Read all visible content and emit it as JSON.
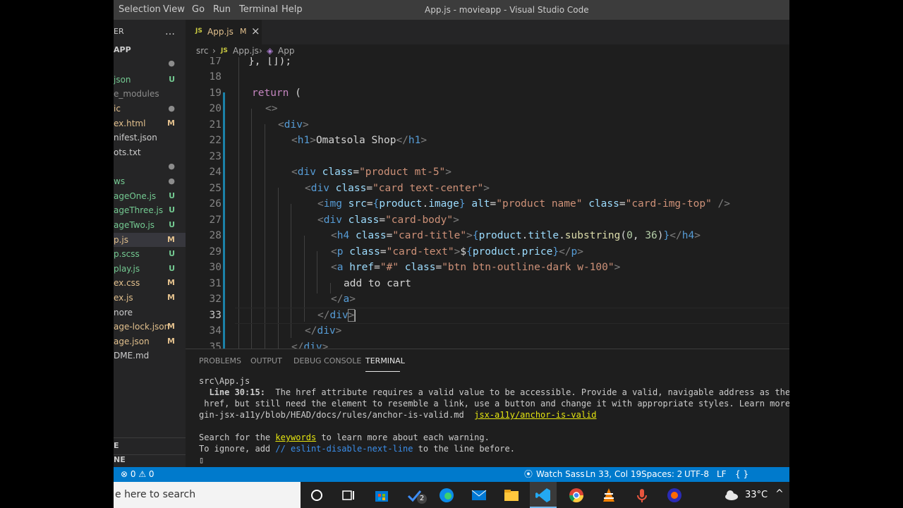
{
  "titlebar": {
    "menus": [
      "Selection",
      "View",
      "Go",
      "Run",
      "Terminal",
      "Help"
    ],
    "title": "App.js - movieapp - Visual Studio Code"
  },
  "sidebar": {
    "header_fragment": "ER",
    "more_icon": "…",
    "project_fragment": "APP",
    "items": [
      {
        "name": "",
        "status": "●",
        "color": "ign"
      },
      {
        "name": "json",
        "status": "U",
        "color": "untracked"
      },
      {
        "name": "e_modules",
        "status": "",
        "color": "ign"
      },
      {
        "name": "ic",
        "status": "●",
        "color": "mod"
      },
      {
        "name": "ex.html",
        "status": "M",
        "color": "mod"
      },
      {
        "name": "nifest.json",
        "status": "",
        "color": "def"
      },
      {
        "name": "ots.txt",
        "status": "",
        "color": "def"
      },
      {
        "name": "",
        "status": "●",
        "color": "ign"
      },
      {
        "name": "ws",
        "status": "●",
        "color": "untracked"
      },
      {
        "name": "ageOne.js",
        "status": "U",
        "color": "untracked"
      },
      {
        "name": "ageThree.js",
        "status": "U",
        "color": "untracked"
      },
      {
        "name": "ageTwo.js",
        "status": "U",
        "color": "untracked"
      },
      {
        "name": "p.js",
        "status": "M",
        "color": "mod"
      },
      {
        "name": "p.scss",
        "status": "U",
        "color": "untracked"
      },
      {
        "name": "play.js",
        "status": "U",
        "color": "untracked"
      },
      {
        "name": "ex.css",
        "status": "M",
        "color": "mod"
      },
      {
        "name": "ex.js",
        "status": "M",
        "color": "mod"
      },
      {
        "name": "nore",
        "status": "",
        "color": "def"
      },
      {
        "name": "age-lock.json",
        "status": "M",
        "color": "mod"
      },
      {
        "name": "age.json",
        "status": "M",
        "color": "mod"
      },
      {
        "name": "DME.md",
        "status": "",
        "color": "def"
      }
    ],
    "bottom_1": "E",
    "bottom_2": "NE"
  },
  "tab": {
    "badge": "JS",
    "name": "App.js",
    "status": "M",
    "close": "×"
  },
  "breadcrumb": {
    "folder": "src",
    "sep": "›",
    "badge": "JS",
    "file": "App.js",
    "symbol": "App"
  },
  "line_numbers": [
    "17",
    "18",
    "19",
    "20",
    "21",
    "22",
    "23",
    "24",
    "25",
    "26",
    "27",
    "28",
    "29",
    "30",
    "31",
    "32",
    "33",
    "34",
    "35"
  ],
  "code": {
    "l17": [
      "}, [",
      "]);"
    ],
    "l19": [
      "return",
      " ("
    ],
    "l20": "<>",
    "l21": [
      "<",
      "div",
      ">"
    ],
    "l22": [
      "<",
      "h1",
      ">",
      "Omatsola Shop",
      "</",
      "h1",
      ">"
    ],
    "l24": [
      "<",
      "div",
      " ",
      "class",
      "=",
      "\"product mt-5\"",
      ">"
    ],
    "l25": [
      "<",
      "div",
      " ",
      "class",
      "=",
      "\"card text-center\"",
      ">"
    ],
    "l26": [
      "<",
      "img",
      " ",
      "src",
      "=",
      "{",
      "product",
      ".",
      "image",
      "}",
      " ",
      "alt",
      "=",
      "\"product name\"",
      " ",
      "class",
      "=",
      "\"card-img-top\"",
      " ",
      "/>"
    ],
    "l27": [
      "<",
      "div",
      " ",
      "class",
      "=",
      "\"card-body\"",
      ">"
    ],
    "l28": [
      "<",
      "h4",
      " ",
      "class",
      "=",
      "\"card-title\"",
      ">",
      "{",
      "product",
      ".",
      "title",
      ".",
      "substring",
      "(",
      "0",
      ", ",
      "36",
      ")",
      "}",
      "</",
      "h4",
      ">"
    ],
    "l29": [
      "<",
      "p",
      " ",
      "class",
      "=",
      "\"card-text\"",
      ">",
      "$",
      "{",
      "product",
      ".",
      "price",
      "}",
      "</",
      "p",
      ">"
    ],
    "l30": [
      "<",
      "a",
      " ",
      "href",
      "=",
      "\"#\"",
      " ",
      "class",
      "=",
      "\"btn btn-outline-dark w-100\"",
      ">"
    ],
    "l31": "add to cart",
    "l32": [
      "</",
      "a",
      ">"
    ],
    "l33": [
      "</",
      "div",
      ">"
    ],
    "l34": [
      "</",
      "div",
      ">"
    ],
    "l35": [
      "</",
      "div",
      ">"
    ]
  },
  "panel": {
    "tabs": [
      "PROBLEMS",
      "OUTPUT",
      "DEBUG CONSOLE",
      "TERMINAL"
    ],
    "terminal": {
      "file": "src\\App.js",
      "rule_loc": "  Line 30:15:",
      "msg1": "  The href attribute requires a valid value to be accessible. Provide a valid, navigable address as the href value.",
      "msg2": " href, but still need the element to resemble a link, use a button and change it with appropriate styles. Learn more: https://gi",
      "msg3": "gin-jsx-a11y/blob/HEAD/docs/rules/anchor-is-valid.md  ",
      "rule": "jsx-a11y/anchor-is-valid",
      "search_pre": "Search for the ",
      "keywords": "keywords",
      "search_post": " to learn more about each warning.",
      "ignore_pre": "To ignore, add ",
      "ignore_code": "// eslint-disable-next-line",
      "ignore_post": " to the line before.",
      "cursor": "▯"
    }
  },
  "statusbar": {
    "errors": "⊗ 0 ⚠ 0",
    "watch_sass": "Watch Sass",
    "position": "Ln 33, Col 19",
    "spaces": "Spaces: 2",
    "encoding": "UTF-8",
    "eol": "LF",
    "language": "{ }  JavaScript"
  },
  "taskbar": {
    "search": "e here to search",
    "badge_count": "2",
    "temperature": "33°C",
    "chevron": "^"
  },
  "colors": {
    "accent": "#007acc",
    "editor_bg": "#1e1e1e",
    "sidebar_bg": "#252526",
    "modified": "#e2c08d",
    "untracked": "#73c991"
  }
}
